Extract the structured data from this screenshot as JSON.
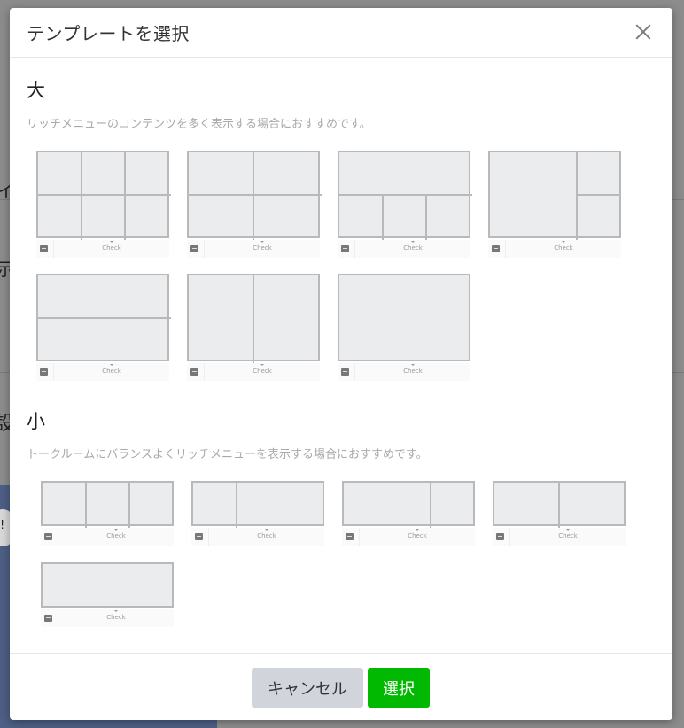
{
  "background": {
    "fragments": [
      "イ",
      "示",
      "設",
      "!"
    ]
  },
  "modal": {
    "title": "テンプレートを選択",
    "close_icon": "close-icon",
    "large": {
      "title": "大",
      "description": "リッチメニューのコンテンツを多く表示する場合におすすめです。"
    },
    "small": {
      "title": "小",
      "description": "トークルームにバランスよくリッチメニューを表示する場合におすすめです。"
    },
    "template_check_label": "Check",
    "template_icon": "menu-icon",
    "footer": {
      "cancel_label": "キャンセル",
      "select_label": "選択"
    }
  },
  "colors": {
    "accent_green": "#00b900",
    "cancel_gray": "#d1d5db",
    "template_fill": "#ebecee",
    "template_border": "#b9b9bb"
  }
}
